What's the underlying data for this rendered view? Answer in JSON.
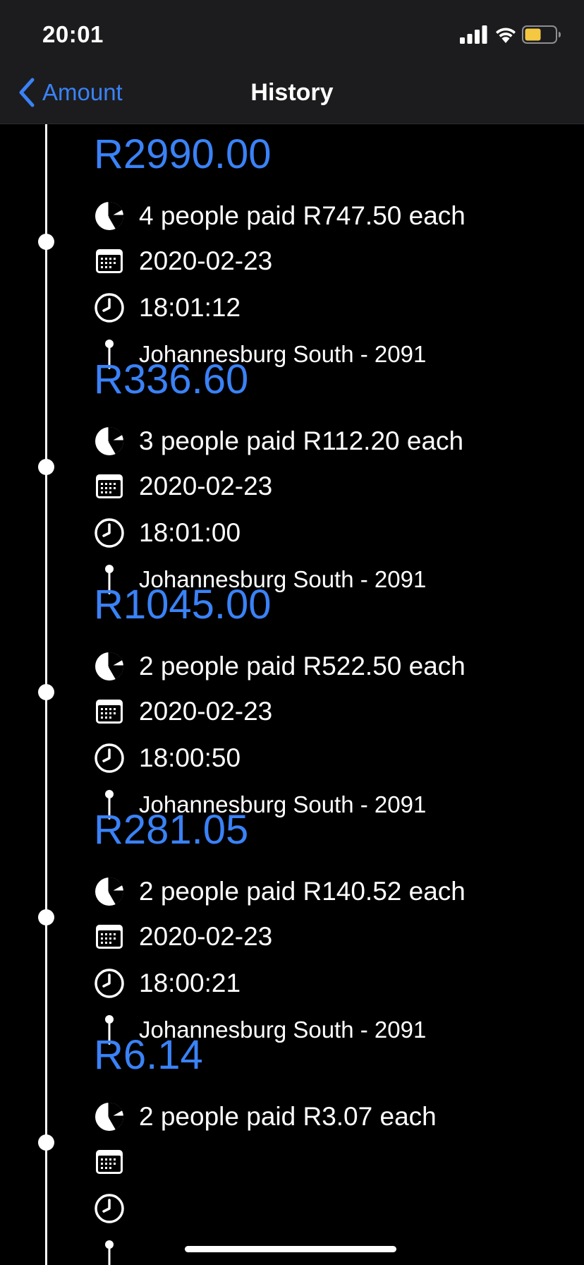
{
  "status_bar": {
    "time": "20:01",
    "battery_color": "#f5c842"
  },
  "nav": {
    "back_label": "Amount",
    "title": "History"
  },
  "colors": {
    "accent": "#3a82f7",
    "background": "#000000",
    "bar": "#1c1c1e"
  },
  "icons": {
    "split": "pie-chart-icon",
    "date": "calendar-icon",
    "time": "clock-icon",
    "location": "pin-icon"
  },
  "entries": [
    {
      "amount": "R2990.00",
      "split": "4 people paid R747.50 each",
      "date": "2020-02-23",
      "time": "18:01:12",
      "location": "Johannesburg South - 2091"
    },
    {
      "amount": "R336.60",
      "split": "3 people paid R112.20 each",
      "date": "2020-02-23",
      "time": "18:01:00",
      "location": "Johannesburg South - 2091"
    },
    {
      "amount": "R1045.00",
      "split": "2 people paid R522.50 each",
      "date": "2020-02-23",
      "time": "18:00:50",
      "location": "Johannesburg South - 2091"
    },
    {
      "amount": "R281.05",
      "split": "2 people paid R140.52 each",
      "date": "2020-02-23",
      "time": "18:00:21",
      "location": "Johannesburg South - 2091"
    },
    {
      "amount": "R6.14",
      "split": "2 people paid R3.07 each",
      "date": "",
      "time": "",
      "location": ""
    }
  ]
}
